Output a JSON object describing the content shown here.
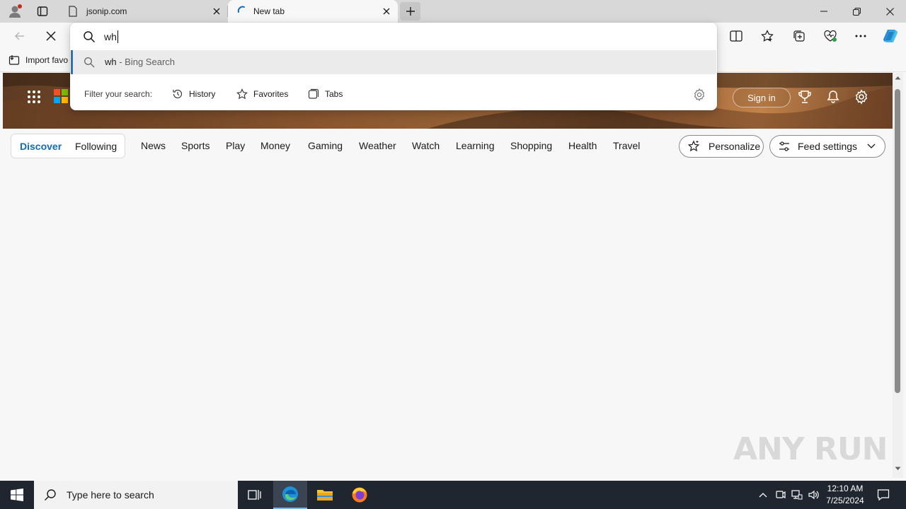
{
  "browser": {
    "tabs": [
      {
        "title": "jsonip.com",
        "active": false
      },
      {
        "title": "New tab",
        "active": true
      }
    ],
    "new_tab_label": "+",
    "favorites_bar": {
      "import_label": "Import favo"
    }
  },
  "omnibox": {
    "query": "wh",
    "suggestion": {
      "term": "wh",
      "suffix": " - Bing Search"
    },
    "filter_label": "Filter your search:",
    "filters": [
      {
        "label": "History",
        "icon": "history-icon"
      },
      {
        "label": "Favorites",
        "icon": "star-icon"
      },
      {
        "label": "Tabs",
        "icon": "tabs-icon"
      }
    ]
  },
  "newtab": {
    "signin_label": "Sign in",
    "nav_pill": {
      "discover": "Discover",
      "following": "Following"
    },
    "nav_items": [
      "News",
      "Sports",
      "Play",
      "Money",
      "Gaming",
      "Weather",
      "Watch",
      "Learning",
      "Shopping",
      "Health",
      "Travel"
    ],
    "personalize_label": "Personalize",
    "feed_settings_label": "Feed settings",
    "accent_color": "#0f6cbd"
  },
  "watermark": "ANY RUN",
  "taskbar": {
    "search_placeholder": "Type here to search",
    "time": "12:10 AM",
    "date": "7/25/2024"
  }
}
